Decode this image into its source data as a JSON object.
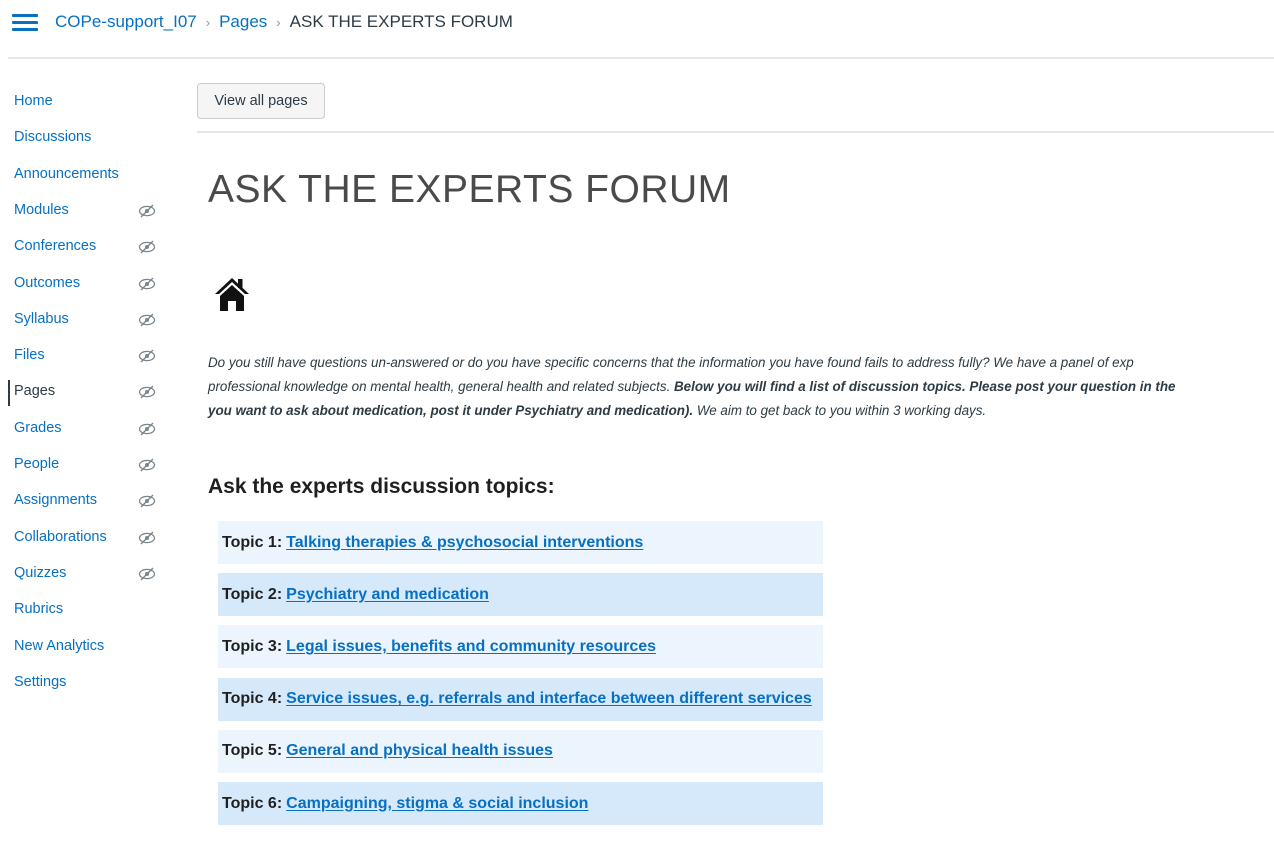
{
  "header": {
    "breadcrumb": {
      "course": "COPe-support_I07",
      "section": "Pages",
      "current": "ASK THE EXPERTS FORUM",
      "separator": "›"
    }
  },
  "sidebar": {
    "items": [
      {
        "label": "Home",
        "hidden": false,
        "active": false
      },
      {
        "label": "Discussions",
        "hidden": false,
        "active": false
      },
      {
        "label": "Announcements",
        "hidden": false,
        "active": false
      },
      {
        "label": "Modules",
        "hidden": true,
        "active": false
      },
      {
        "label": "Conferences",
        "hidden": true,
        "active": false
      },
      {
        "label": "Outcomes",
        "hidden": true,
        "active": false
      },
      {
        "label": "Syllabus",
        "hidden": true,
        "active": false
      },
      {
        "label": "Files",
        "hidden": true,
        "active": false
      },
      {
        "label": "Pages",
        "hidden": true,
        "active": true
      },
      {
        "label": "Grades",
        "hidden": true,
        "active": false
      },
      {
        "label": "People",
        "hidden": true,
        "active": false
      },
      {
        "label": "Assignments",
        "hidden": true,
        "active": false
      },
      {
        "label": "Collaborations",
        "hidden": true,
        "active": false
      },
      {
        "label": "Quizzes",
        "hidden": true,
        "active": false
      },
      {
        "label": "Rubrics",
        "hidden": false,
        "active": false
      },
      {
        "label": "New Analytics",
        "hidden": false,
        "active": false
      },
      {
        "label": "Settings",
        "hidden": false,
        "active": false
      }
    ],
    "hidden_icon": "eye-slash-icon"
  },
  "main": {
    "view_all_label": "View all pages",
    "title": "ASK THE EXPERTS FORUM",
    "page_icon": "home-icon",
    "intro": {
      "line1": "Do you still have questions un-answered or do you have specific concerns that the information you have found fails to address fully? We have a panel of exp",
      "line2_plain": "professional knowledge on mental health, general health and related subjects. ",
      "line2_bold": "Below you will find a list of discussion topics. Please post your question in the",
      "line3_bold": "you want to ask about medication, post it under Psychiatry and medication).",
      "line3_plain": " We aim to get back to you within 3 working days."
    },
    "topics_heading": "Ask the experts discussion topics:",
    "topics": [
      {
        "prefix": "Topic 1:",
        "link": "Talking therapies & psychosocial interventions"
      },
      {
        "prefix": "Topic 2:",
        "link": "Psychiatry and medication"
      },
      {
        "prefix": "Topic 3:",
        "link": "Legal issues, benefits and community resources"
      },
      {
        "prefix": "Topic 4:",
        "link": "Service issues, e.g. referrals and interface between different services"
      },
      {
        "prefix": "Topic 5:",
        "link": "General and physical health issues"
      },
      {
        "prefix": "Topic 6:",
        "link": "Campaigning, stigma & social inclusion"
      }
    ]
  },
  "colors": {
    "link": "#0770c2",
    "text": "#2d3b45",
    "row_light": "#ecf5fd",
    "row_dark": "#d5e9fb"
  }
}
